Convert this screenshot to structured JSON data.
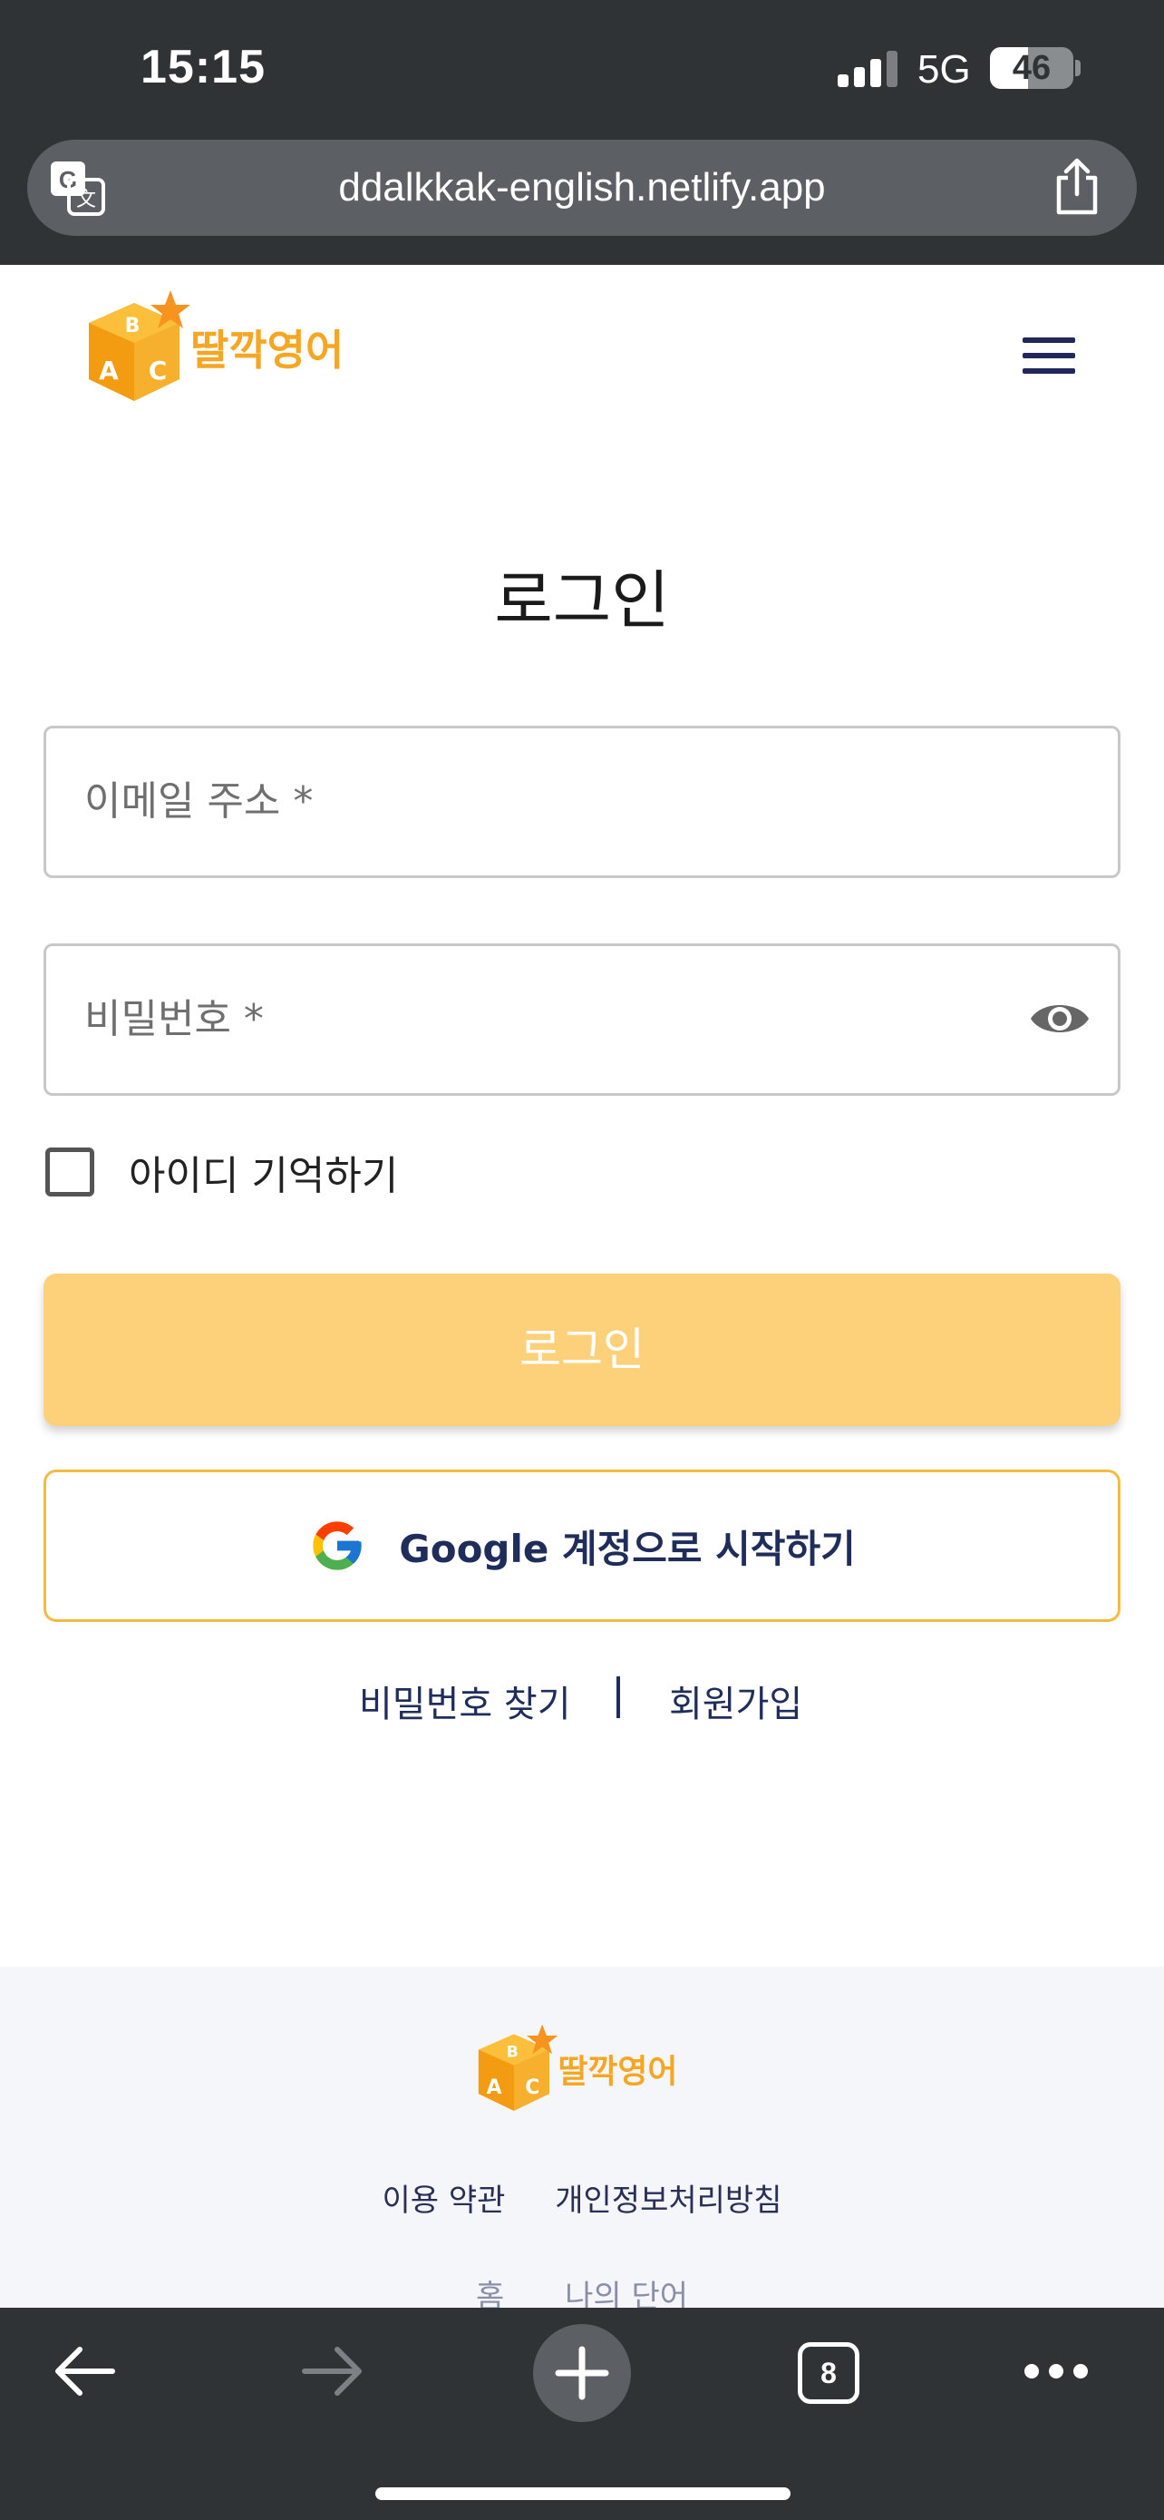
{
  "status_bar": {
    "time": "15:15",
    "network": "5G",
    "battery": "46",
    "battery_level": 0.46
  },
  "browser": {
    "url": "ddalkkak-english.netlify.app"
  },
  "header": {
    "logo_text": "딸깍영어",
    "logo_cube_letters": [
      "A",
      "B",
      "C"
    ]
  },
  "login": {
    "title": "로그인",
    "email_placeholder": "이메일 주소 *",
    "password_placeholder": "비밀번호 *",
    "remember_label": "아이디 기억하기",
    "remember_checked": false,
    "login_button": "로그인",
    "google_button": "Google 계정으로 시작하기",
    "find_password": "비밀번호 찾기",
    "signup": "회원가입"
  },
  "footer": {
    "logo_text": "딸깍영어",
    "terms": "이용 약관",
    "privacy": "개인정보처리방침",
    "nav_home": "홈",
    "nav_words": "나의 단어"
  },
  "toolbar": {
    "tab_count": "8"
  },
  "colors": {
    "chrome_bg": "#303336",
    "brand_orange": "#f39c12",
    "login_button_bg": "#fdd179",
    "google_border": "#f4bc3e",
    "navy_text": "#1f2d5a",
    "footer_bg": "#f4f6fa"
  },
  "icons": [
    "translate-icon",
    "share-icon",
    "menu-icon",
    "eye-icon",
    "google-icon",
    "back-arrow-icon",
    "forward-arrow-icon",
    "plus-icon",
    "tabs-icon",
    "more-icon"
  ]
}
